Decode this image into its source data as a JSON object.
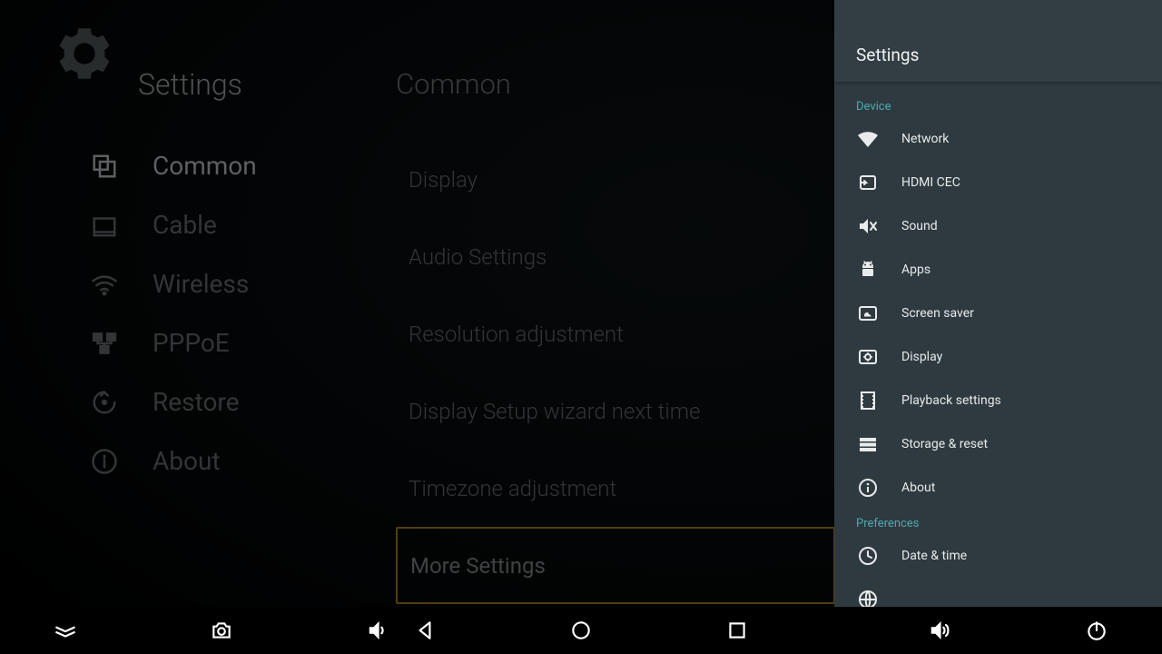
{
  "bg": {
    "title": "Settings",
    "main_title": "Common",
    "sidebar": [
      {
        "label": "Common",
        "active": true,
        "icon": "common"
      },
      {
        "label": "Cable",
        "active": false,
        "icon": "cable"
      },
      {
        "label": "Wireless",
        "active": false,
        "icon": "wifi"
      },
      {
        "label": "PPPoE",
        "active": false,
        "icon": "pppoe"
      },
      {
        "label": "Restore",
        "active": false,
        "icon": "restore"
      },
      {
        "label": "About",
        "active": false,
        "icon": "about"
      }
    ],
    "rows": [
      {
        "label": "Display",
        "value": "",
        "focused": false
      },
      {
        "label": "Audio Settings",
        "value": "",
        "focused": false
      },
      {
        "label": "Resolution adjustment",
        "value": "",
        "focused": false
      },
      {
        "label": "Display Setup wizard next time",
        "value": "",
        "focused": false
      },
      {
        "label": "Timezone adjustment",
        "value": "",
        "focused": false
      },
      {
        "label": "More Settings",
        "value": "",
        "focused": true
      }
    ]
  },
  "panel": {
    "title": "Settings",
    "sections": [
      {
        "label": "Device",
        "items": [
          {
            "label": "Network",
            "icon": "wifi-solid",
            "name": "panel-item-network"
          },
          {
            "label": "HDMI CEC",
            "icon": "hdmi",
            "name": "panel-item-hdmi-cec"
          },
          {
            "label": "Sound",
            "icon": "sound-mute",
            "name": "panel-item-sound"
          },
          {
            "label": "Apps",
            "icon": "android",
            "name": "panel-item-apps"
          },
          {
            "label": "Screen saver",
            "icon": "dream",
            "name": "panel-item-screensaver"
          },
          {
            "label": "Display",
            "icon": "display",
            "name": "panel-item-display"
          },
          {
            "label": "Playback settings",
            "icon": "film",
            "name": "panel-item-playback"
          },
          {
            "label": "Storage & reset",
            "icon": "storage",
            "name": "panel-item-storage"
          },
          {
            "label": "About",
            "icon": "info",
            "name": "panel-item-about"
          }
        ]
      },
      {
        "label": "Preferences",
        "items": [
          {
            "label": "Date & time",
            "icon": "clock",
            "name": "panel-item-date-time"
          },
          {
            "label": "",
            "icon": "globe",
            "name": "panel-item-language"
          }
        ]
      }
    ]
  }
}
